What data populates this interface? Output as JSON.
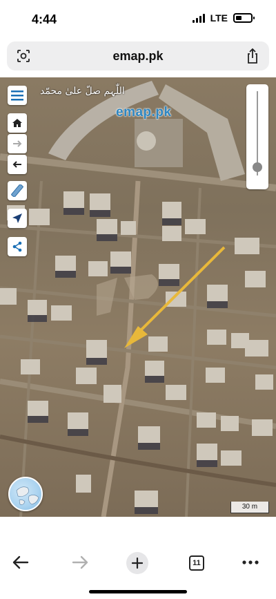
{
  "status_bar": {
    "time": "4:44",
    "network": "LTE"
  },
  "browser": {
    "url": "emap.pk"
  },
  "map": {
    "logo_text": "emap.pk",
    "calligraphy": "اللّٰہم صلّ علیٰ محمّد",
    "scale_label": "30 m",
    "zoom_level": 0.9,
    "arrow_color": "#e8b83a"
  },
  "bottom_bar": {
    "tab_count": "11"
  },
  "icons": {
    "lens": "lens-icon",
    "share": "share-icon",
    "menu": "menu-icon",
    "home": "home-icon",
    "forward_arrow": "arrow-right-icon",
    "back_arrow": "arrow-left-icon",
    "ruler": "ruler-icon",
    "locate": "locate-icon",
    "share_map": "share-nodes-icon",
    "globe": "globe-icon",
    "nav_back": "back-icon",
    "nav_forward": "forward-icon",
    "new_tab": "plus-icon",
    "tabs": "tabs-icon",
    "more": "more-icon"
  }
}
